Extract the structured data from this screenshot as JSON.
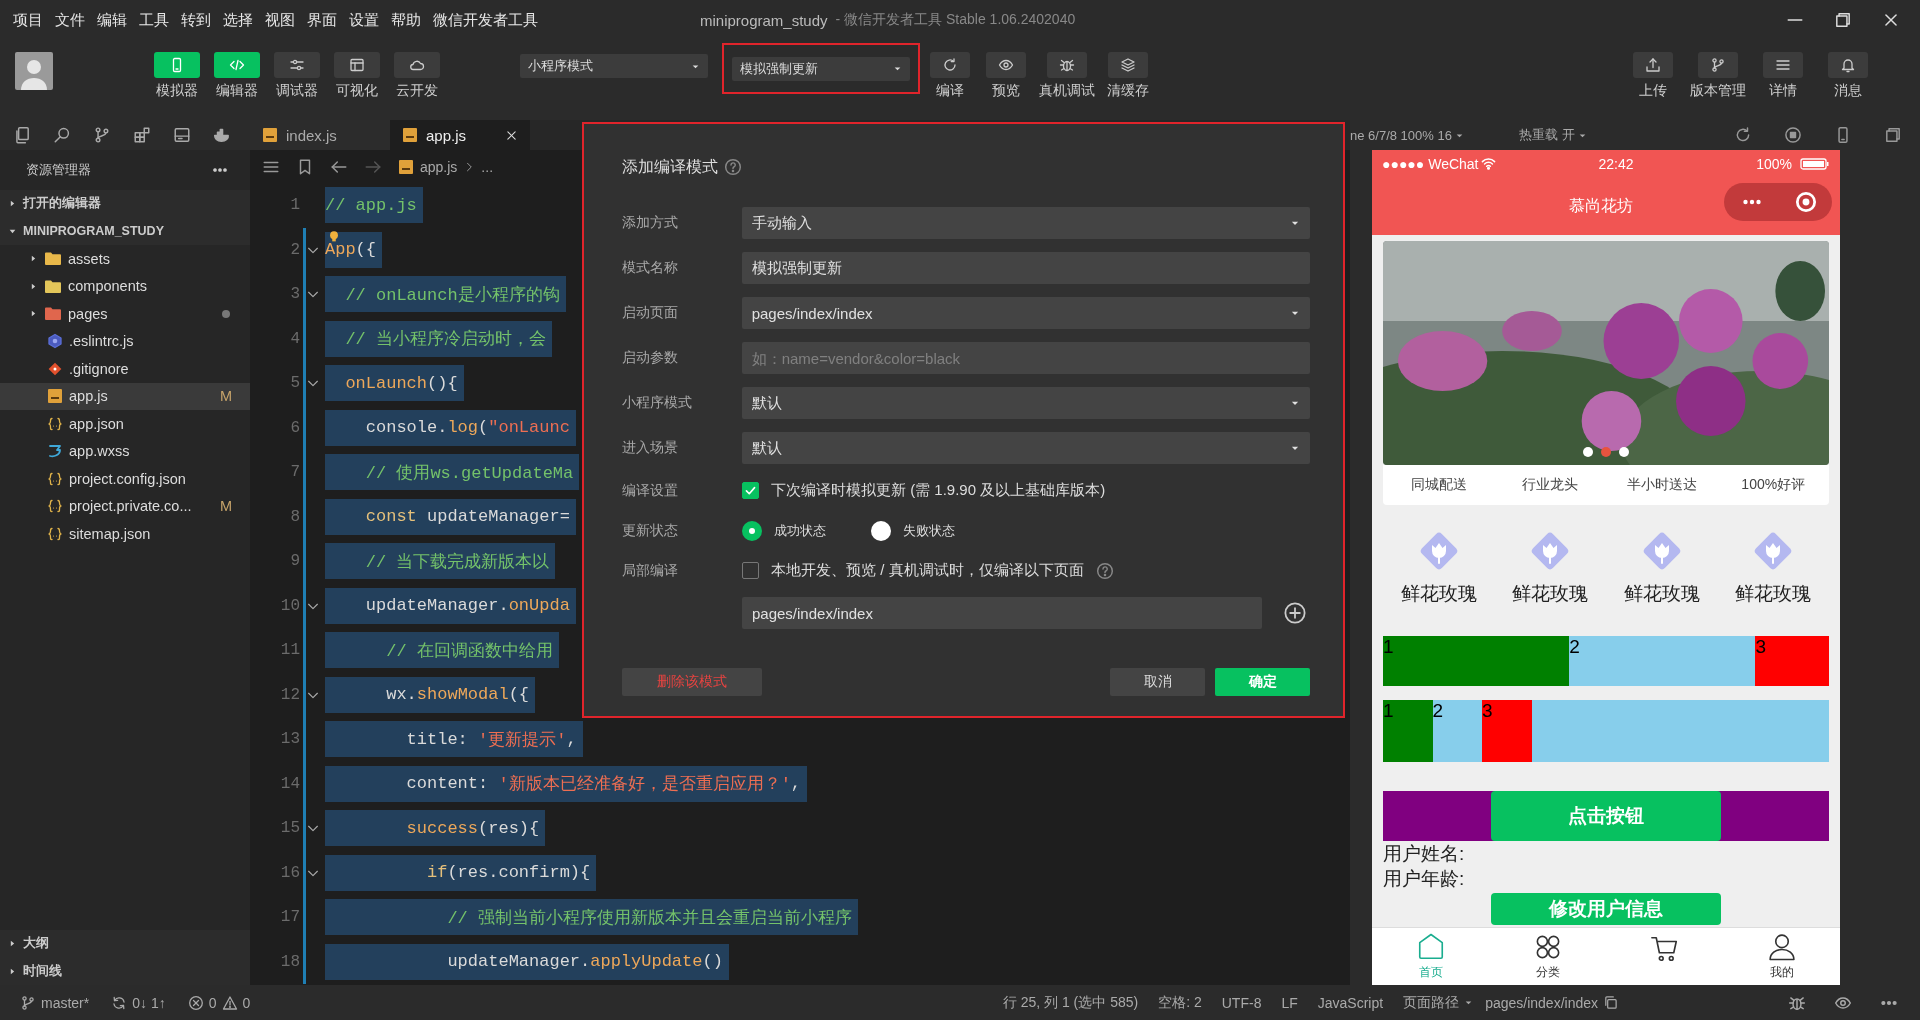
{
  "menu_bar": {
    "items": [
      "项目",
      "文件",
      "编辑",
      "工具",
      "转到",
      "选择",
      "视图",
      "界面",
      "设置",
      "帮助",
      "微信开发者工具"
    ],
    "project_title": "miniprogram_study",
    "app_title": "- 微信开发者工具 Stable 1.06.2402040"
  },
  "toolbar": {
    "view_buttons": [
      {
        "label": "模拟器",
        "selected": true
      },
      {
        "label": "编辑器",
        "selected": true
      },
      {
        "label": "调试器",
        "selected": false
      },
      {
        "label": "可视化",
        "selected": false
      },
      {
        "label": "云开发",
        "selected": false
      }
    ],
    "mode_select": {
      "value": "小程序模式"
    },
    "compile_select": {
      "value": "模拟强制更新",
      "highlighted": true
    },
    "action_buttons": [
      "编译",
      "预览",
      "真机调试",
      "清缓存"
    ],
    "right_buttons": [
      "上传",
      "版本管理",
      "详情",
      "消息"
    ]
  },
  "sidebar": {
    "title": "资源管理器",
    "sections": [
      {
        "label": "打开的编辑器",
        "expanded": false
      },
      {
        "label": "MINIPROGRAM_STUDY",
        "expanded": true,
        "children": [
          {
            "name": "assets",
            "kind": "folder",
            "color": "#e8b84a",
            "expanded": false,
            "selected": false,
            "changed": false
          },
          {
            "name": "components",
            "kind": "folder",
            "color": "#e3c65a",
            "expanded": false,
            "selected": false,
            "changed": false
          },
          {
            "name": "pages",
            "kind": "folder",
            "color": "#e0664d",
            "expanded": false,
            "selected": false,
            "changed": true
          },
          {
            "name": ".eslintrc.js",
            "kind": "eslint",
            "selected": false,
            "changed": false
          },
          {
            "name": ".gitignore",
            "kind": "git",
            "selected": false,
            "changed": false
          },
          {
            "name": "app.js",
            "kind": "js",
            "selected": true,
            "changed": false,
            "badge": "M"
          },
          {
            "name": "app.json",
            "kind": "json",
            "selected": false,
            "changed": false
          },
          {
            "name": "app.wxss",
            "kind": "wxss",
            "selected": false,
            "changed": false
          },
          {
            "name": "project.config.json",
            "kind": "json",
            "selected": false,
            "changed": false
          },
          {
            "name": "project.private.co...",
            "kind": "json",
            "selected": false,
            "changed": false,
            "badge": "M"
          },
          {
            "name": "sitemap.json",
            "kind": "json",
            "selected": false,
            "changed": false
          }
        ]
      }
    ],
    "bottom_sections": [
      {
        "label": "大纲",
        "expanded": false
      },
      {
        "label": "时间线",
        "expanded": false
      }
    ]
  },
  "editor": {
    "tabs": [
      {
        "label": "index.js",
        "selected": false
      },
      {
        "label": "app.js",
        "selected": true
      }
    ],
    "breadcrumb": [
      "app.js",
      "..."
    ],
    "lines": [
      {
        "number": "1",
        "fold": false,
        "lightbulb": false,
        "segments": [
          {
            "kind": "comment",
            "text": "// app.js"
          }
        ]
      },
      {
        "number": "2",
        "fold": true,
        "lightbulb": true,
        "segments": [
          {
            "kind": "fn",
            "text": "App"
          },
          {
            "kind": "plain",
            "text": "({"
          }
        ]
      },
      {
        "number": "3",
        "fold": true,
        "lightbulb": false,
        "segments": [
          {
            "kind": "comment",
            "text": "  // onLaunch是小程序的钩"
          }
        ]
      },
      {
        "number": "4",
        "fold": false,
        "lightbulb": false,
        "segments": [
          {
            "kind": "comment",
            "text": "  // 当小程序冷启动时，会"
          }
        ]
      },
      {
        "number": "5",
        "fold": true,
        "lightbulb": false,
        "segments": [
          {
            "kind": "fn",
            "text": "  onLaunch"
          },
          {
            "kind": "plain",
            "text": "(){"
          }
        ]
      },
      {
        "number": "6",
        "fold": false,
        "lightbulb": false,
        "segments": [
          {
            "kind": "plain",
            "text": "    console."
          },
          {
            "kind": "fn",
            "text": "log"
          },
          {
            "kind": "plain",
            "text": "("
          },
          {
            "kind": "str",
            "text": "\"onLaunc"
          }
        ]
      },
      {
        "number": "7",
        "fold": false,
        "lightbulb": false,
        "segments": [
          {
            "kind": "comment",
            "text": "    // 使用ws.getUpdateMa"
          }
        ]
      },
      {
        "number": "8",
        "fold": false,
        "lightbulb": false,
        "segments": [
          {
            "kind": "kw",
            "text": "    const"
          },
          {
            "kind": "plain",
            "text": " updateManager="
          }
        ]
      },
      {
        "number": "9",
        "fold": false,
        "lightbulb": false,
        "segments": [
          {
            "kind": "comment",
            "text": "    // 当下载完成新版本以"
          }
        ]
      },
      {
        "number": "10",
        "fold": true,
        "lightbulb": false,
        "segments": [
          {
            "kind": "plain",
            "text": "    updateManager."
          },
          {
            "kind": "fn",
            "text": "onUpda"
          }
        ]
      },
      {
        "number": "11",
        "fold": false,
        "lightbulb": false,
        "segments": [
          {
            "kind": "comment",
            "text": "      // 在回调函数中给用"
          }
        ]
      },
      {
        "number": "12",
        "fold": true,
        "lightbulb": false,
        "segments": [
          {
            "kind": "plain",
            "text": "      wx."
          },
          {
            "kind": "fn",
            "text": "showModal"
          },
          {
            "kind": "plain",
            "text": "({"
          }
        ]
      },
      {
        "number": "13",
        "fold": false,
        "lightbulb": false,
        "segments": [
          {
            "kind": "plain",
            "text": "        title: "
          },
          {
            "kind": "str",
            "text": "'更新提示'"
          },
          {
            "kind": "plain",
            "text": ","
          }
        ]
      },
      {
        "number": "14",
        "fold": false,
        "lightbulb": false,
        "segments": [
          {
            "kind": "plain",
            "text": "        content: "
          },
          {
            "kind": "str",
            "text": "'新版本已经准备好，是否重启应用？'"
          },
          {
            "kind": "plain",
            "text": ","
          }
        ]
      },
      {
        "number": "15",
        "fold": true,
        "lightbulb": false,
        "segments": [
          {
            "kind": "fn",
            "text": "        success"
          },
          {
            "kind": "plain",
            "text": "(res){"
          }
        ]
      },
      {
        "number": "16",
        "fold": true,
        "lightbulb": false,
        "segments": [
          {
            "kind": "kw",
            "text": "          if"
          },
          {
            "kind": "plain",
            "text": "(res.confirm){"
          }
        ]
      },
      {
        "number": "17",
        "fold": false,
        "lightbulb": false,
        "segments": [
          {
            "kind": "comment",
            "text": "            // 强制当前小程序使用新版本并且会重启当前小程序"
          }
        ]
      },
      {
        "number": "18",
        "fold": false,
        "lightbulb": false,
        "segments": [
          {
            "kind": "plain",
            "text": "            updateManager."
          },
          {
            "kind": "fn",
            "text": "applyUpdate"
          },
          {
            "kind": "plain",
            "text": "()"
          }
        ]
      }
    ]
  },
  "dialog": {
    "title": "添加编译模式",
    "highlighted": true,
    "fields": [
      {
        "label": "添加方式",
        "kind": "select",
        "value": "手动输入"
      },
      {
        "label": "模式名称",
        "kind": "input",
        "value": "模拟强制更新"
      },
      {
        "label": "启动页面",
        "kind": "select",
        "value": "pages/index/index"
      },
      {
        "label": "启动参数",
        "kind": "input",
        "placeholder": "如：name=vendor&color=black"
      },
      {
        "label": "小程序模式",
        "kind": "select",
        "value": "默认"
      },
      {
        "label": "进入场景",
        "kind": "select",
        "value": "默认"
      },
      {
        "label": "编译设置",
        "kind": "checkbox",
        "checked": true,
        "text": "下次编译时模拟更新 (需 1.9.90 及以上基础库版本)"
      },
      {
        "label": "更新状态",
        "kind": "radio",
        "options": [
          {
            "label": "成功状态",
            "selected": true
          },
          {
            "label": "失败状态",
            "selected": false
          }
        ]
      },
      {
        "label": "局部编译",
        "kind": "checkbox",
        "checked": false,
        "text": "本地开发、预览 / 真机调试时，仅编译以下页面"
      },
      {
        "kind": "page_input",
        "value": "pages/index/index"
      }
    ],
    "buttons": [
      {
        "label": "删除该模式",
        "kind": "danger"
      },
      {
        "label": "取消",
        "kind": "default"
      },
      {
        "label": "确定",
        "kind": "primary"
      }
    ]
  },
  "simulator": {
    "device": "ne 6/7/8 100% 16",
    "hot_reload": "热重载 开",
    "phone": {
      "carrier": "●●●●● WeChat",
      "time": "22:42",
      "battery": "100%",
      "nav_title": "慕尚花坊",
      "banner": {
        "kind": "picture",
        "dots": [
          {
            "selected": false
          },
          {
            "selected": true
          },
          {
            "selected": false
          }
        ]
      },
      "features": [
        "同城配送",
        "行业龙头",
        "半小时送达",
        "100%好评"
      ],
      "categories": [
        "鲜花玫瑰",
        "鲜花玫瑰",
        "鲜花玫瑰",
        "鲜花玫瑰"
      ],
      "flex_rows": [
        {
          "items": [
            {
              "label": "1",
              "color": "#008000"
            },
            {
              "label": "2",
              "color": "#87ceeb"
            },
            {
              "label": "3",
              "color": "#ff0000"
            }
          ]
        },
        {
          "items": [
            {
              "label": "1",
              "color": "#008000"
            },
            {
              "label": "2",
              "color": "#87ceeb"
            },
            {
              "label": "3",
              "color": "#ff0000"
            }
          ]
        }
      ],
      "click_button": "点击按钮",
      "user_fields": [
        "用户姓名:",
        "用户年龄:"
      ],
      "update_button": "修改用户信息",
      "tabbar": [
        {
          "label": "首页",
          "selected": true
        },
        {
          "label": "分类",
          "selected": false
        },
        {
          "selected": false
        },
        {
          "label": "我的",
          "selected": false
        }
      ]
    }
  },
  "status_bar": {
    "branch": "master*",
    "sync": "0↓ 1↑",
    "errors": "0",
    "warnings": "0",
    "position": "行 25, 列 1 (选中 585)",
    "indent": "空格: 2",
    "encoding": "UTF-8",
    "eol": "LF",
    "language": "JavaScript",
    "page_path_label": "页面路径",
    "page_path": "pages/index/index"
  }
}
